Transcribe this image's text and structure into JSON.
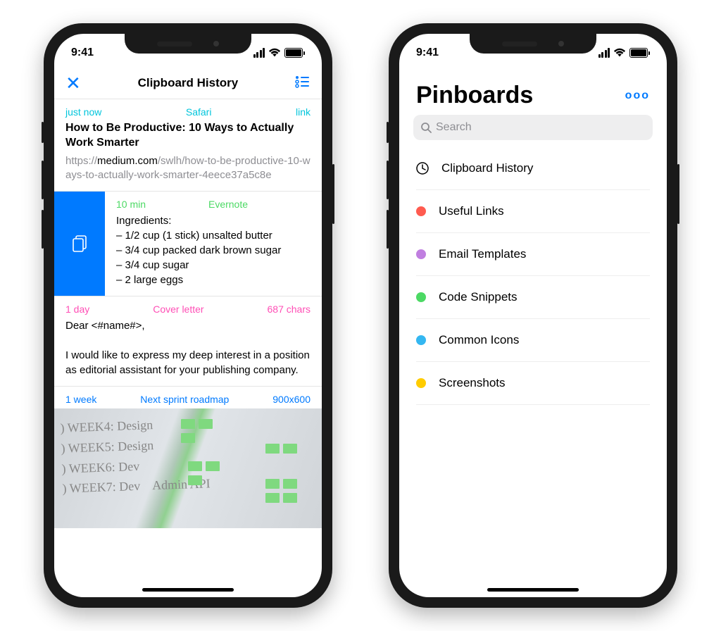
{
  "status": {
    "time": "9:41"
  },
  "left": {
    "title": "Clipboard History",
    "entries": [
      {
        "time": "just now",
        "source": "Safari",
        "tag": "link",
        "color": "c-cyan",
        "headline": "How to Be Productive: 10 Ways to Actually Work Smarter",
        "urlPrefix": "https://",
        "urlBold": "medium.com",
        "urlRest": "/swlh/how-to-be-productive-10-ways-to-actually-work-smarter-4eece37a5c8e"
      },
      {
        "time": "10 min",
        "source": "Evernote",
        "color": "c-green",
        "body": "Ingredients:\n – 1/2 cup (1 stick) unsalted butter\n – 3/4 cup packed dark brown sugar\n – 3/4 cup sugar\n – 2 large eggs"
      },
      {
        "time": "1 day",
        "source": "Cover letter",
        "tag": "687 chars",
        "color": "c-pink",
        "body": "Dear <#name#>,\n\nI would like to express my deep interest in a position as editorial assistant for your publishing company."
      },
      {
        "time": "1 week",
        "source": "Next sprint roadmap",
        "tag": "900x600",
        "color": "c-blue"
      }
    ]
  },
  "right": {
    "title": "Pinboards",
    "searchPlaceholder": "Search",
    "items": [
      {
        "label": "Clipboard History",
        "type": "clock"
      },
      {
        "label": "Useful Links",
        "color": "#ff5b4f"
      },
      {
        "label": "Email Templates",
        "color": "#c07fe0"
      },
      {
        "label": "Code Snippets",
        "color": "#4cd964"
      },
      {
        "label": "Common Icons",
        "color": "#34b7f1"
      },
      {
        "label": "Screenshots",
        "color": "#ffcc00"
      }
    ]
  }
}
